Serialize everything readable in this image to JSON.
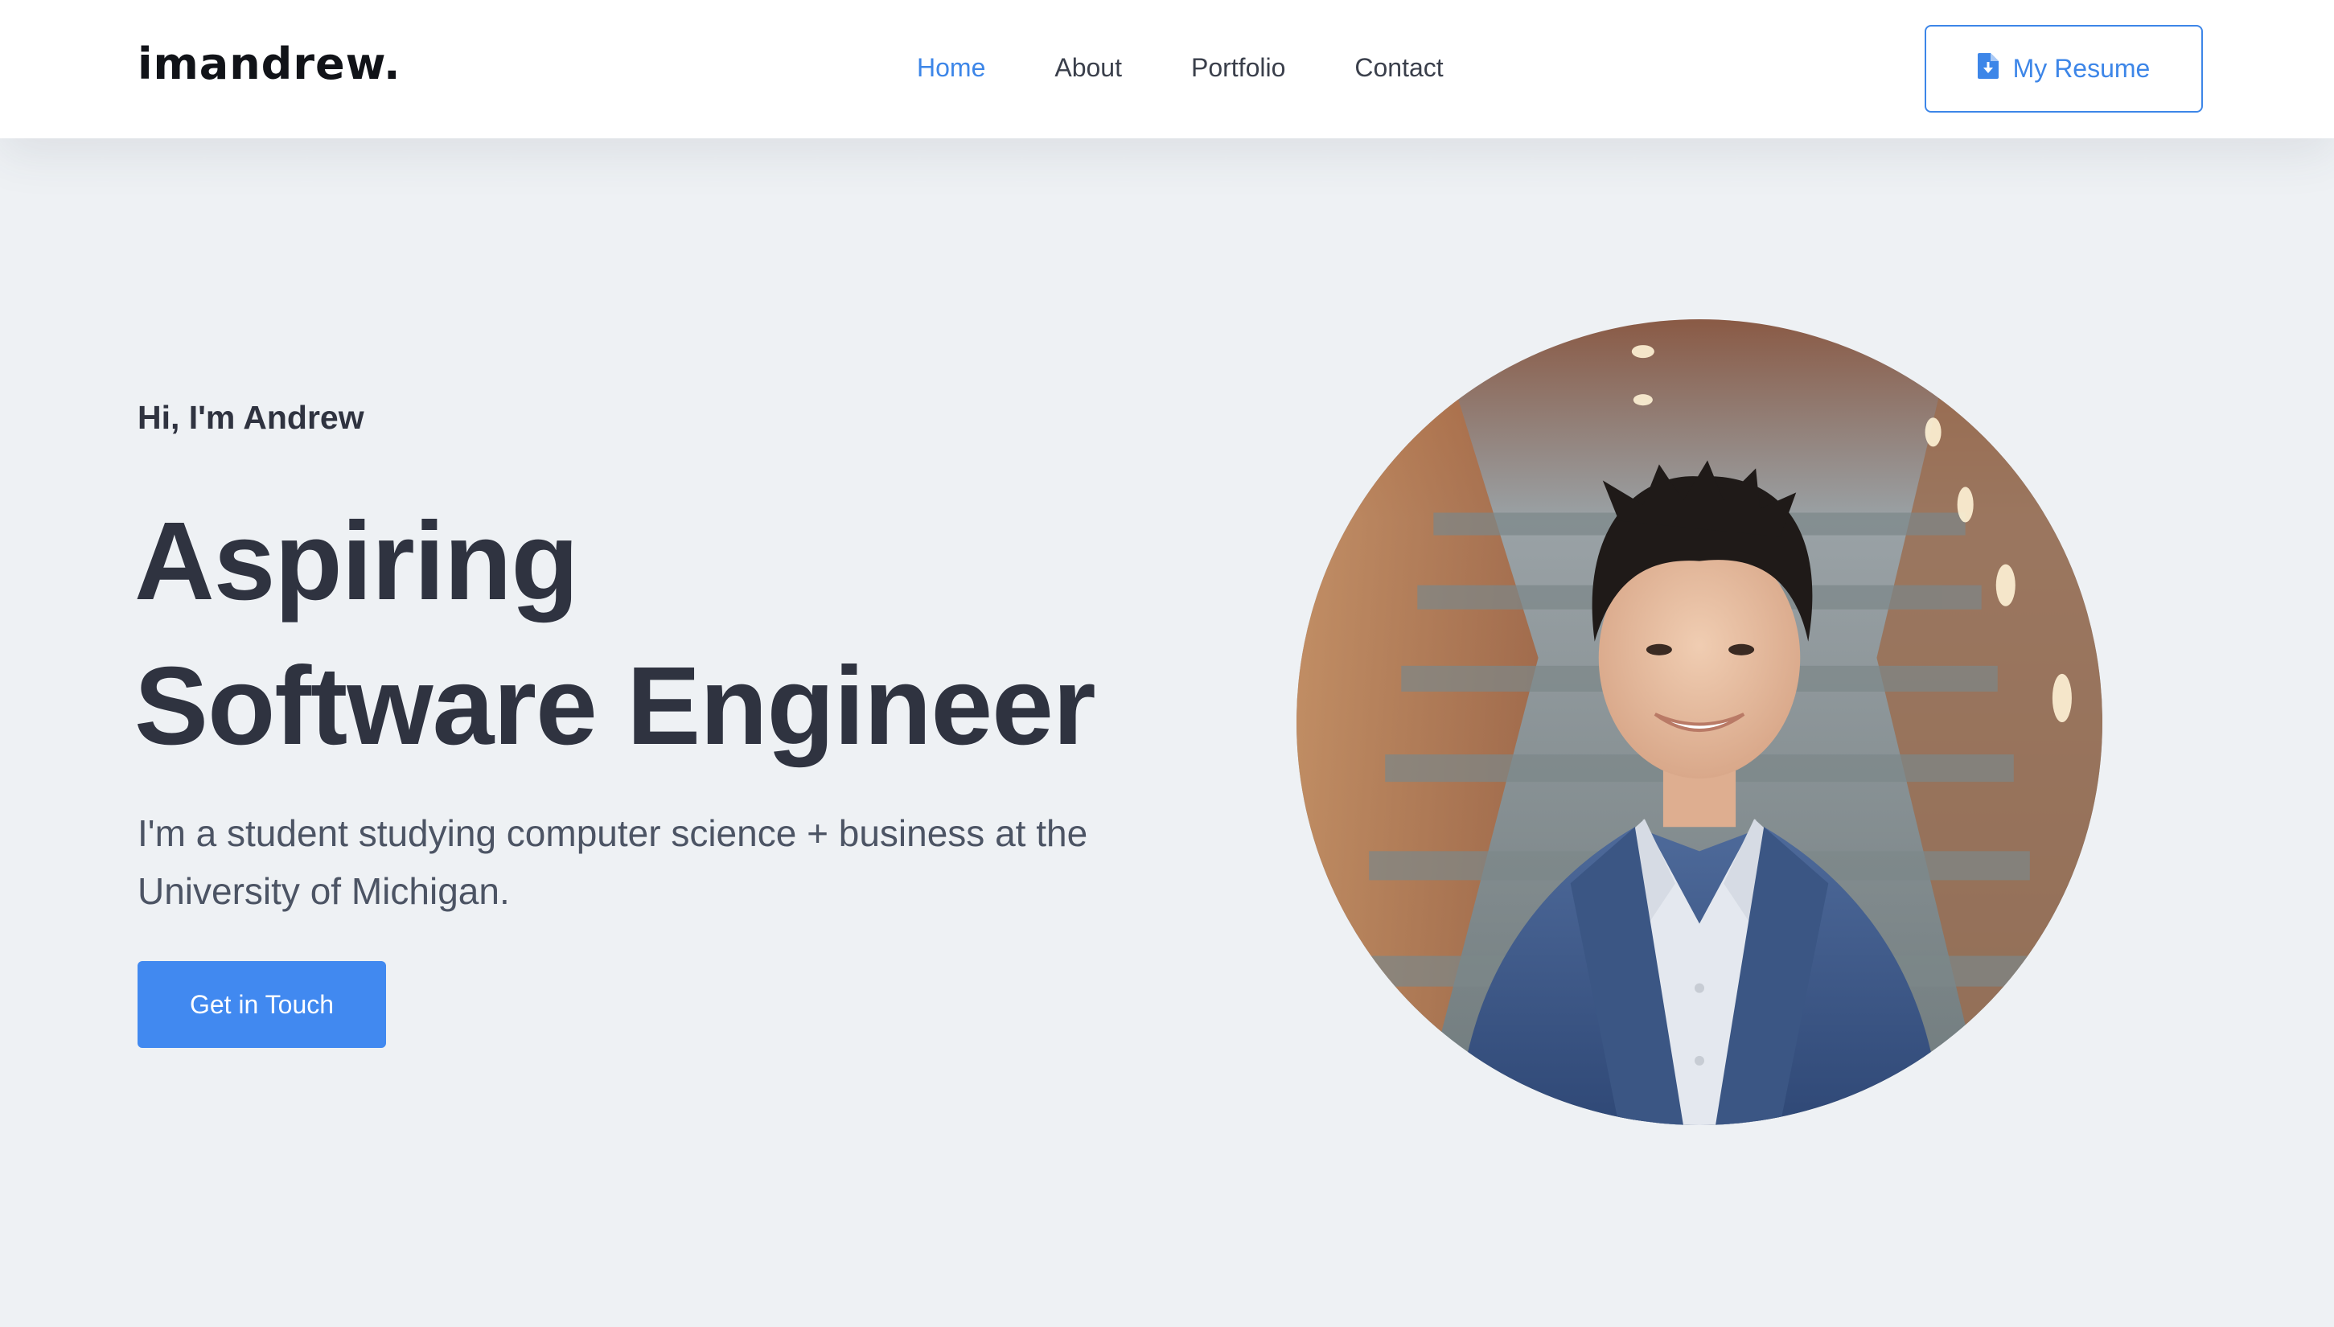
{
  "nav": {
    "logo": "imandrew.",
    "links": [
      "Home",
      "About",
      "Portfolio",
      "Contact"
    ],
    "active_link": "Home",
    "resume_label": "My Resume",
    "resume_icon": "file-download-icon"
  },
  "hero": {
    "greeting": "Hi, I'm Andrew",
    "title_line1": "Aspiring",
    "title_line2": "Software Engineer",
    "description": "I'm a student studying computer science + business at the University of Michigan.",
    "cta_label": "Get in Touch"
  },
  "colors": {
    "accent": "#3d86e8",
    "cta": "#4189f0",
    "background": "#eef1f4",
    "text": "#2f3340"
  }
}
